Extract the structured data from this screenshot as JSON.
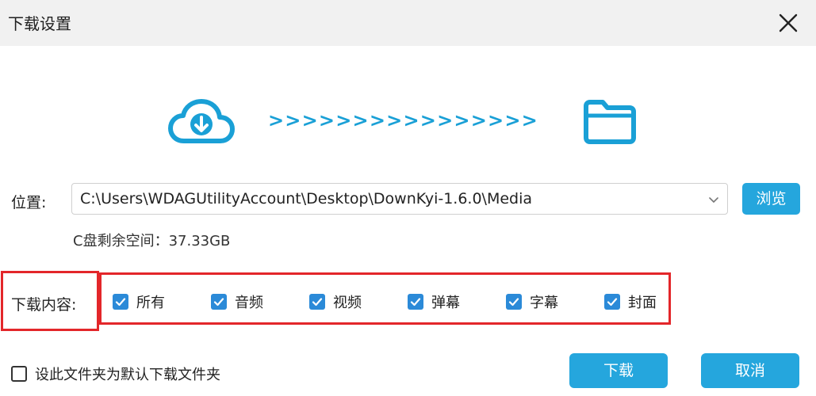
{
  "window": {
    "title": "下载设置",
    "close_icon": "close-icon"
  },
  "banner": {
    "cloud_icon": "cloud-download-icon",
    "arrows_text": ">>>>>>>>>>>>>>>>",
    "folder_icon": "folder-icon"
  },
  "location": {
    "label": "位置:",
    "path": "C:\\Users\\WDAGUtilityAccount\\Desktop\\DownKyi-1.6.0\\Media",
    "browse_label": "浏览",
    "free_space": "C盘剩余空间：37.33GB"
  },
  "content": {
    "label": "下载内容:",
    "options": [
      {
        "label": "所有",
        "checked": true
      },
      {
        "label": "音频",
        "checked": true
      },
      {
        "label": "视频",
        "checked": true
      },
      {
        "label": "弹幕",
        "checked": true
      },
      {
        "label": "字幕",
        "checked": true
      },
      {
        "label": "封面",
        "checked": true
      }
    ]
  },
  "footer": {
    "default_folder_label": "设此文件夹为默认下载文件夹",
    "default_folder_checked": false,
    "download_label": "下载",
    "cancel_label": "取消"
  },
  "colors": {
    "accent": "#25a6dd",
    "checkbox": "#2b8ad8",
    "highlight": "#e3262a",
    "titlebar": "#f1f1f1"
  }
}
